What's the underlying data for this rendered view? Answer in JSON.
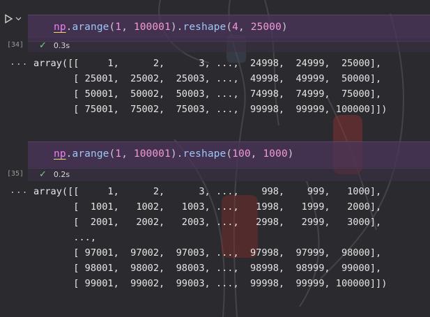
{
  "cells": [
    {
      "exec_count": "[34]",
      "code_tokens": [
        {
          "t": "np",
          "k": "np"
        },
        {
          "t": ".",
          "k": "punc"
        },
        {
          "t": "arange",
          "k": "fn"
        },
        {
          "t": "(",
          "k": "punc"
        },
        {
          "t": "1",
          "k": "num"
        },
        {
          "t": ", ",
          "k": "punc"
        },
        {
          "t": "100001",
          "k": "num"
        },
        {
          "t": ").",
          "k": "punc"
        },
        {
          "t": "reshape",
          "k": "fn"
        },
        {
          "t": "(",
          "k": "punc"
        },
        {
          "t": "4",
          "k": "num"
        },
        {
          "t": ", ",
          "k": "punc"
        },
        {
          "t": "25000",
          "k": "num"
        },
        {
          "t": ")",
          "k": "punc"
        }
      ],
      "status_icon": "check-icon",
      "duration": "0.3s",
      "output_marker": "...",
      "output_lines": [
        "array([[     1,      2,      3, ...,  24998,  24999,  25000],",
        "       [ 25001,  25002,  25003, ...,  49998,  49999,  50000],",
        "       [ 50001,  50002,  50003, ...,  74998,  74999,  75000],",
        "       [ 75001,  75002,  75003, ...,  99998,  99999, 100000]])"
      ]
    },
    {
      "exec_count": "[35]",
      "code_tokens": [
        {
          "t": "np",
          "k": "np"
        },
        {
          "t": ".",
          "k": "punc"
        },
        {
          "t": "arange",
          "k": "fn"
        },
        {
          "t": "(",
          "k": "punc"
        },
        {
          "t": "1",
          "k": "num"
        },
        {
          "t": ", ",
          "k": "punc"
        },
        {
          "t": "100001",
          "k": "num"
        },
        {
          "t": ").",
          "k": "punc"
        },
        {
          "t": "reshape",
          "k": "fn"
        },
        {
          "t": "(",
          "k": "punc"
        },
        {
          "t": "100",
          "k": "num"
        },
        {
          "t": ", ",
          "k": "punc"
        },
        {
          "t": "1000",
          "k": "num"
        },
        {
          "t": ")",
          "k": "punc"
        }
      ],
      "status_icon": "check-icon",
      "duration": "0.2s",
      "output_marker": "...",
      "output_lines": [
        "array([[     1,      2,      3, ...,    998,    999,   1000],",
        "       [  1001,   1002,   1003, ...,   1998,   1999,   2000],",
        "       [  2001,   2002,   2003, ...,   2998,   2999,   3000],",
        "       ...,",
        "       [ 97001,  97002,  97003, ...,  97998,  97999,  98000],",
        "       [ 98001,  98002,  98003, ...,  98998,  98999,  99000],",
        "       [ 99001,  99002,  99003, ...,  99998,  99999, 100000]])"
      ]
    }
  ],
  "run_icon": "play-icon",
  "run_dropdown_icon": "chevron-down-icon",
  "colors": {
    "background": "#2b2b2f",
    "cell_input_bg": "#4a3458",
    "keyword_np": "#f07ef0",
    "function": "#9cc7f7",
    "number": "#f39ad9",
    "check": "#7fd08a"
  }
}
